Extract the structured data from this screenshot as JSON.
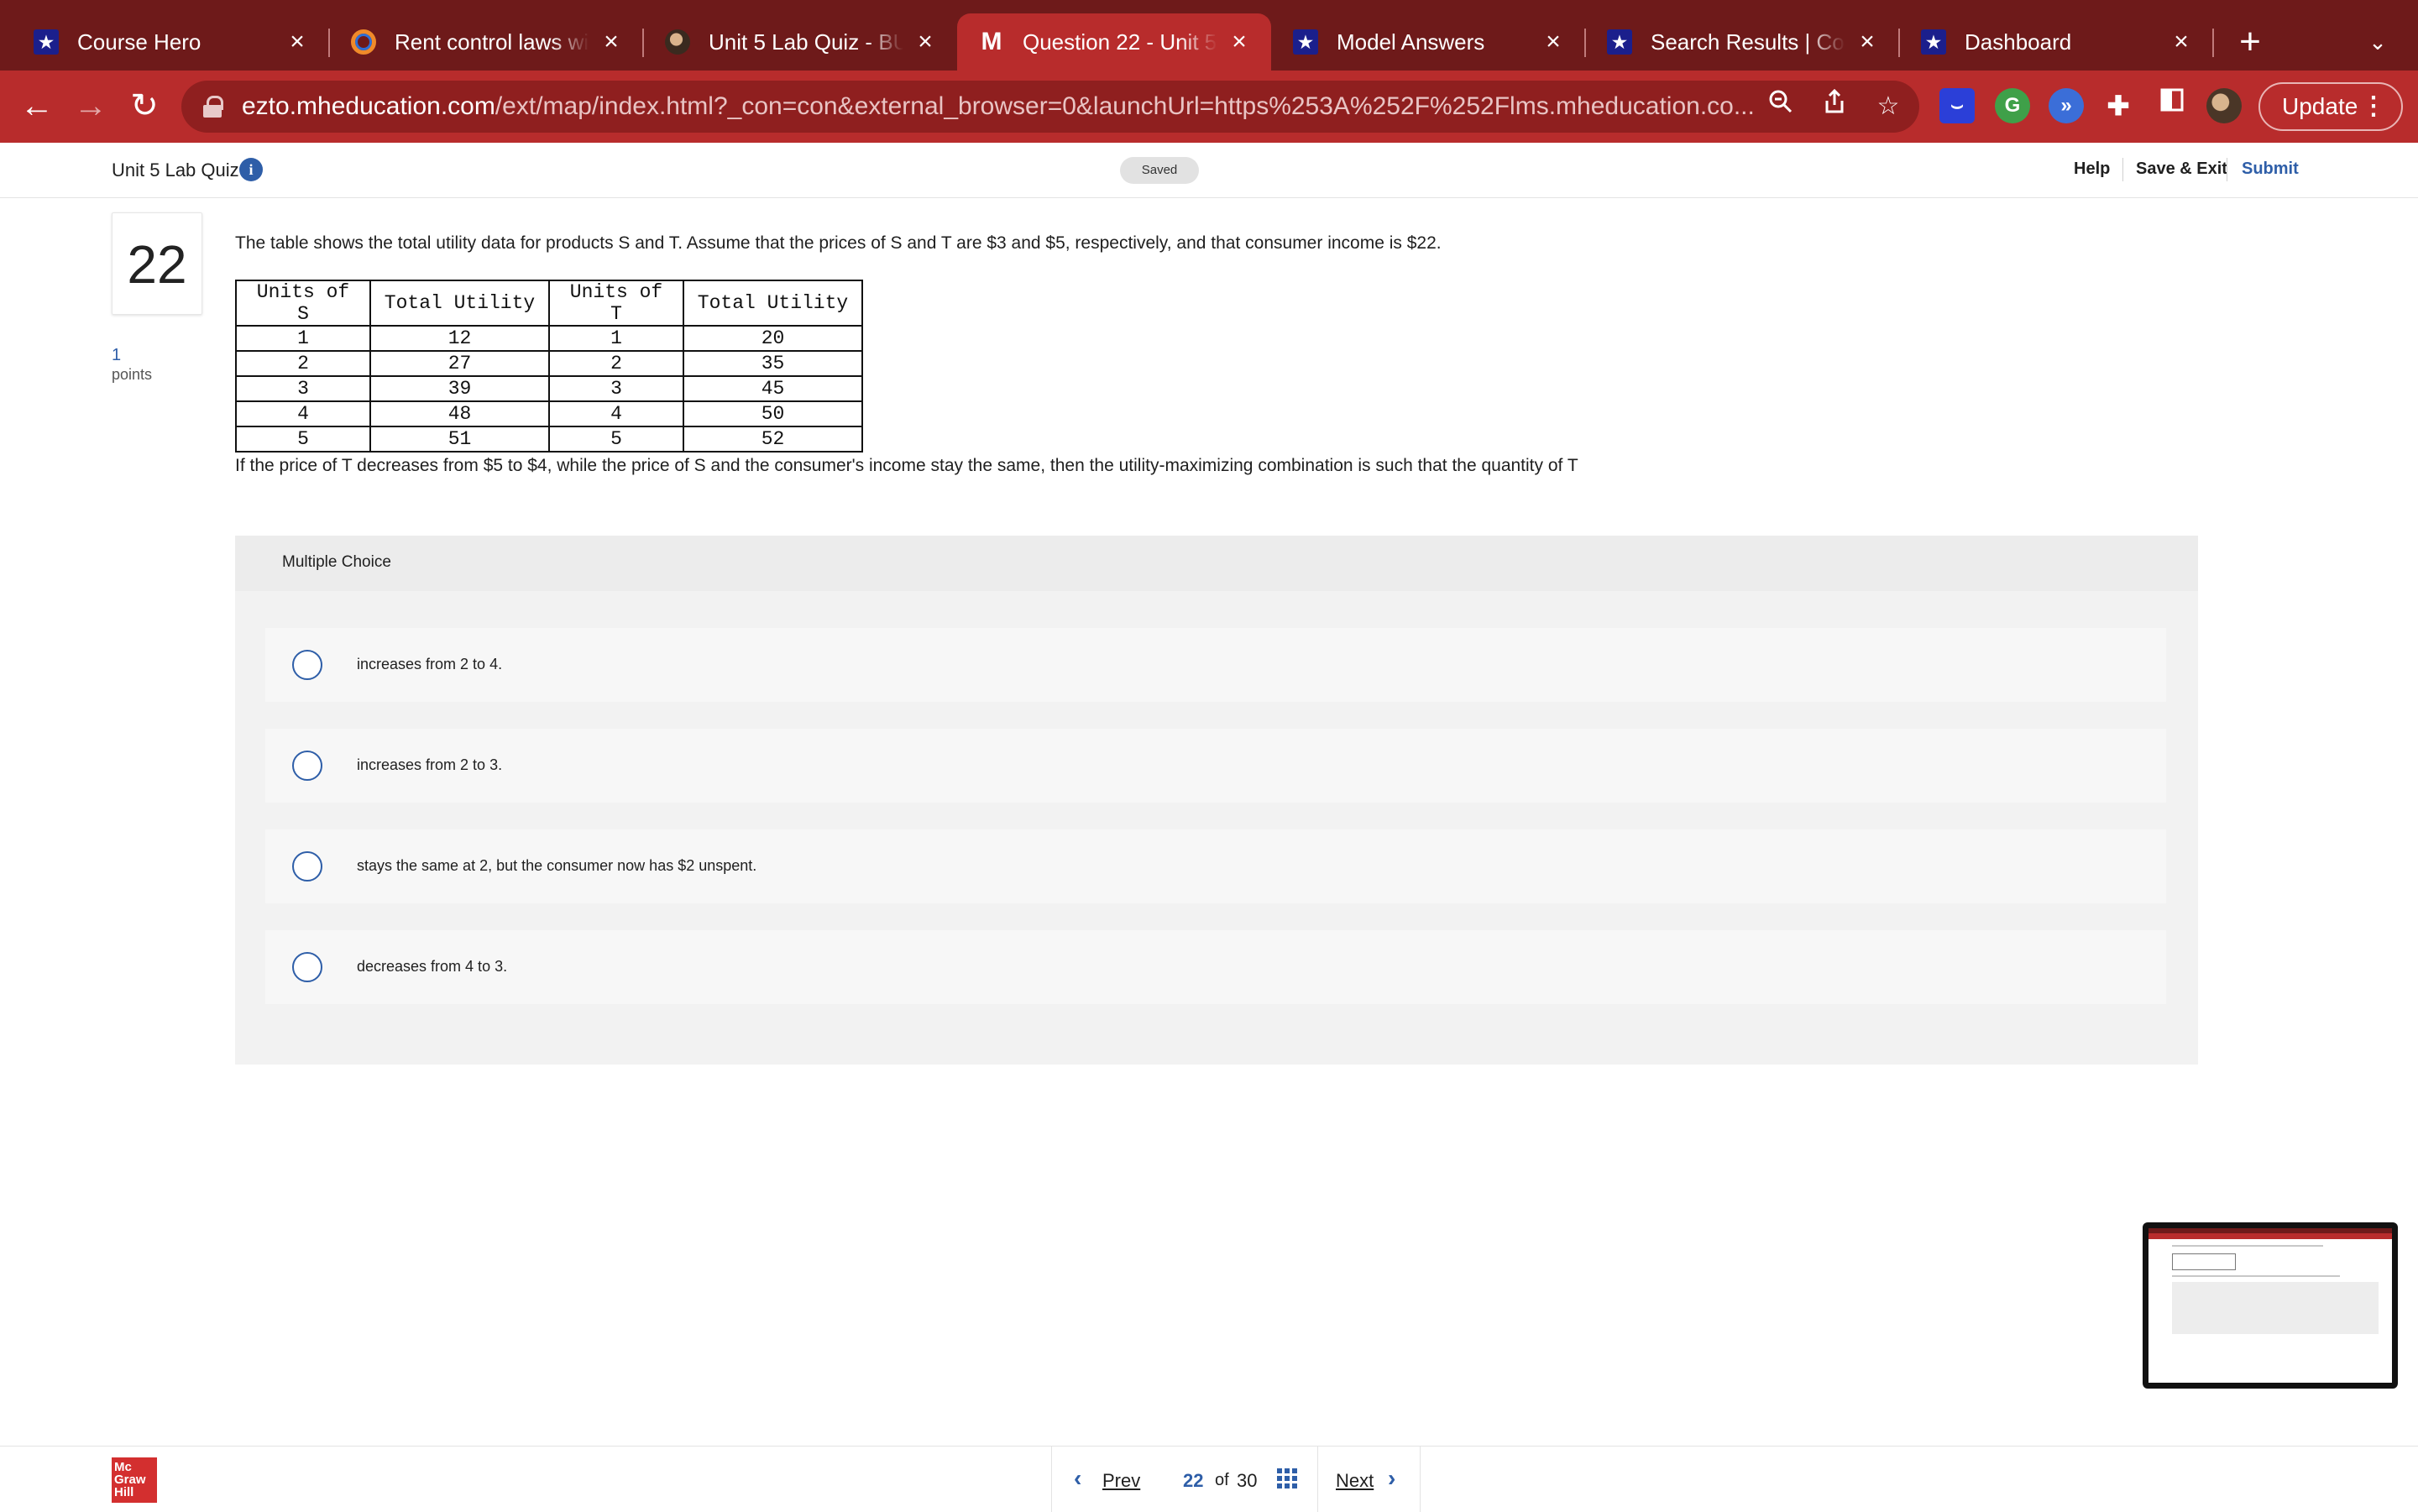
{
  "browser": {
    "tabs": [
      {
        "title": "Course Hero",
        "icon": "star-icon"
      },
      {
        "title": "Rent control laws will",
        "icon": "ring-icon"
      },
      {
        "title": "Unit 5 Lab Quiz - BU",
        "icon": "photo-icon"
      },
      {
        "title": "Question 22 - Unit 5",
        "icon": "mh-icon",
        "active": true
      },
      {
        "title": "Model Answers",
        "icon": "star-icon"
      },
      {
        "title": "Search Results | Cou",
        "icon": "star-icon"
      },
      {
        "title": "Dashboard",
        "icon": "star-icon"
      }
    ],
    "new_tab_glyph": "+",
    "url_host": "ezto.mheducation.com",
    "url_path": "/ext/map/index.html?_con=con&external_browser=0&launchUrl=https%253A%252F%252Flms.mheducation.co...",
    "update_label": "Update",
    "accent_dark": "#6e1a1a",
    "accent": "#b82c2c"
  },
  "quiz": {
    "title": "Unit 5 Lab Quiz",
    "status": "Saved",
    "help": "Help",
    "save_exit": "Save & Exit",
    "submit": "Submit"
  },
  "question": {
    "number": "22",
    "points_value": "1",
    "points_label": "points",
    "prompt": "The table shows the total utility data for products S and T. Assume that the prices of S and T are $3 and $5, respectively, and that consumer income is $22.",
    "table": {
      "headers": [
        "Units of S",
        "Total Utility",
        "Units of T",
        "Total Utility"
      ],
      "rows": [
        [
          "1",
          "12",
          "1",
          "20"
        ],
        [
          "2",
          "27",
          "2",
          "35"
        ],
        [
          "3",
          "39",
          "3",
          "45"
        ],
        [
          "4",
          "48",
          "4",
          "50"
        ],
        [
          "5",
          "51",
          "5",
          "52"
        ]
      ]
    },
    "followup": "If the price of T decreases from $5 to $4, while the price of S and the consumer's income stay the same, then the utility-maximizing combination is such that the quantity of T"
  },
  "multiple_choice": {
    "label": "Multiple Choice",
    "options": [
      "increases from 2 to 4.",
      "increases from 2 to 3.",
      "stays the same at 2, but the consumer now has $2 unspent.",
      "decreases from 4 to 3."
    ]
  },
  "footer": {
    "logo": "Mc Graw Hill",
    "prev": "Prev",
    "current": "22",
    "of": "of",
    "total": "30",
    "next": "Next"
  }
}
